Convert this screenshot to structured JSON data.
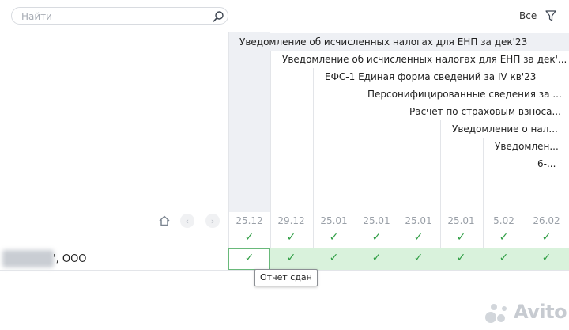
{
  "search": {
    "placeholder": "Найти",
    "value": ""
  },
  "filter": {
    "label": "Все"
  },
  "documents": [
    "Уведомление об исчисленных налогах для ЕНП за дек'23",
    "Уведомление об исчисленных налогах для ЕНП за дек'...",
    "ЕФС-1 Единая форма сведений за IV кв'23",
    "Персонифицированные сведения за ...",
    "Расчет по страховым взноса...",
    "Уведомление о нал...",
    "Уведомлен...",
    "6-..."
  ],
  "dates": [
    "25.12",
    "29.12",
    "25.01",
    "25.01",
    "25.01",
    "25.01",
    "5.02",
    "26.02"
  ],
  "header_checks": [
    "✓",
    "✓",
    "✓",
    "✓",
    "✓",
    "✓",
    "✓",
    "✓"
  ],
  "row": {
    "name": "', ООО",
    "checks": [
      "✓",
      "✓",
      "✓",
      "✓",
      "✓",
      "✓",
      "✓",
      "✓"
    ]
  },
  "tooltip": "Отчет сдан",
  "watermark": "Avito",
  "colors": {
    "accent_green": "#2f9e44",
    "row_green": "#d9f2dc",
    "highlight_col": "#eef0f4"
  }
}
